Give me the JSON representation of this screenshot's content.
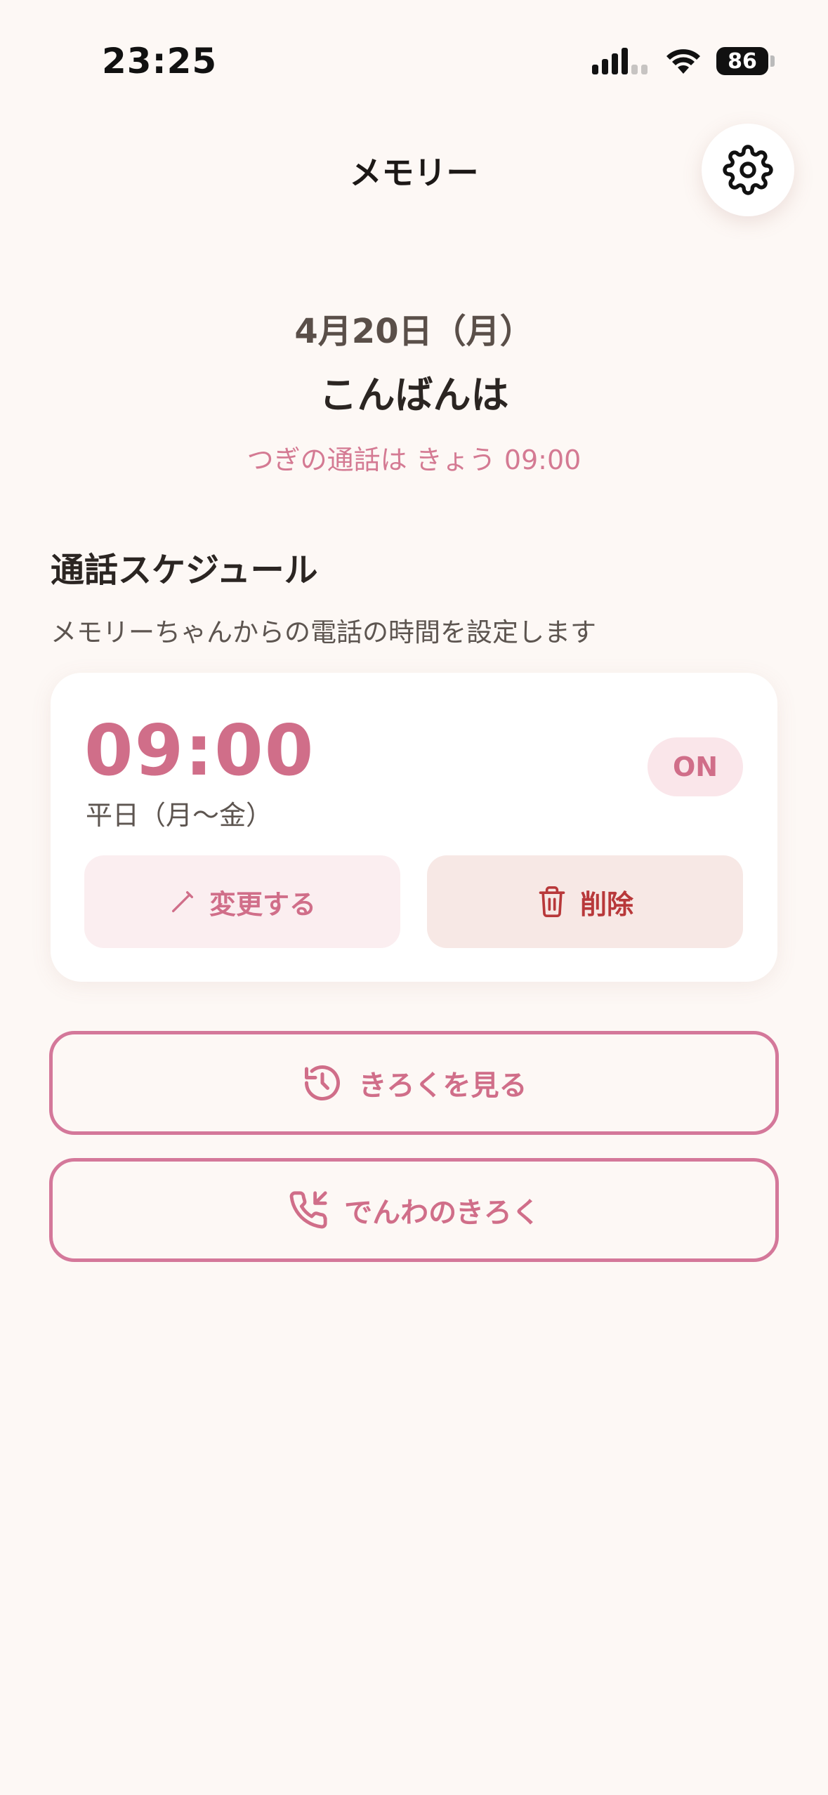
{
  "status_bar": {
    "time": "23:25",
    "battery": "86",
    "icons": [
      "cellular-signal-icon",
      "wifi-icon",
      "battery-icon"
    ]
  },
  "header": {
    "title": "メモリー",
    "settings_icon": "gear-icon"
  },
  "greeting": {
    "date": "4月20日（月）",
    "message": "こんばんは",
    "next_call": "つぎの通話は きょう 09:00"
  },
  "schedule": {
    "title": "通話スケジュール",
    "description": "メモリーちゃんからの電話の時間を設定します",
    "items": [
      {
        "time": "09:00",
        "days": "平日（月〜金）",
        "status": "ON",
        "edit_label": "変更する",
        "delete_label": "削除"
      }
    ]
  },
  "actions": {
    "history_label": "きろくを見る",
    "calls_label": "でんわのきろく"
  },
  "colors": {
    "background": "#fdf8f5",
    "accent": "#d06e89",
    "accent_border": "#d4789a",
    "delete": "#b8383a"
  }
}
